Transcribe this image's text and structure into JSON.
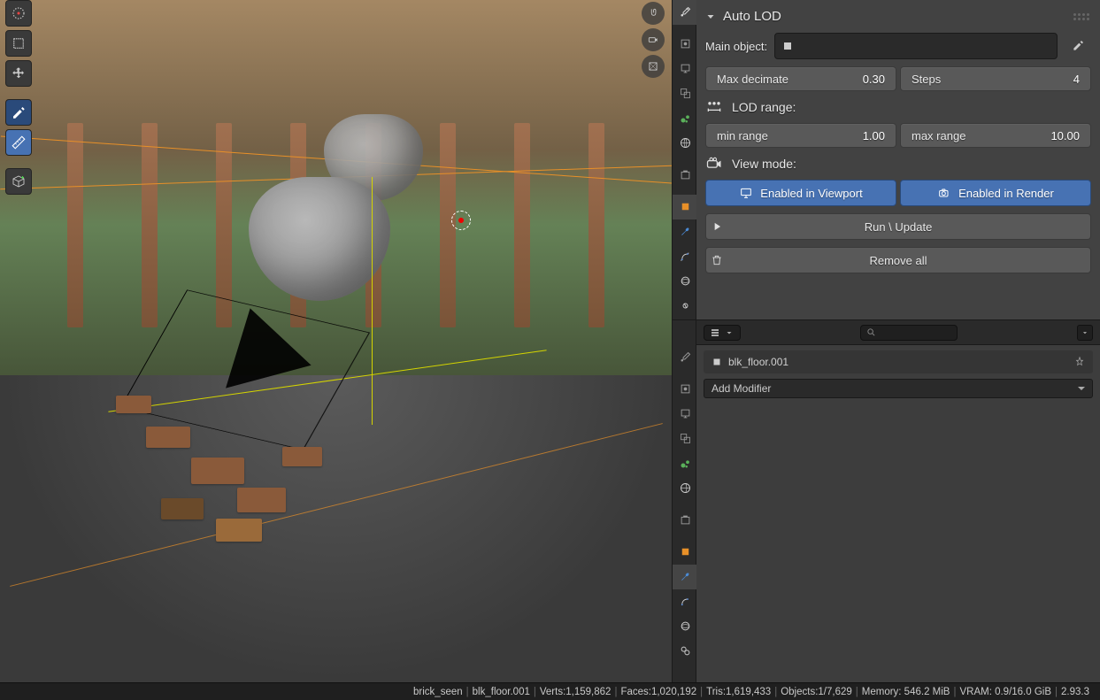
{
  "panel": {
    "title": "Auto LOD",
    "main_object_label": "Main object:",
    "max_decimate_label": "Max decimate",
    "max_decimate_value": "0.30",
    "steps_label": "Steps",
    "steps_value": "4",
    "lod_range_label": "LOD range:",
    "min_range_label": "min range",
    "min_range_value": "1.00",
    "max_range_label": "max range",
    "max_range_value": "10.00",
    "view_mode_label": "View mode:",
    "viewport_toggle": "Enabled in Viewport",
    "render_toggle": "Enabled in Render",
    "run_label": "Run \\ Update",
    "remove_label": "Remove all"
  },
  "modifier": {
    "object_name": "blk_floor.001",
    "add_label": "Add Modifier"
  },
  "status": {
    "scene": "brick_seen",
    "object": "blk_floor.001",
    "verts": "Verts:1,159,862",
    "faces": "Faces:1,020,192",
    "tris": "Tris:1,619,433",
    "objects": "Objects:1/7,629",
    "memory": "Memory: 546.2 MiB",
    "vram": "VRAM: 0.9/16.0 GiB",
    "version": "2.93.3"
  }
}
